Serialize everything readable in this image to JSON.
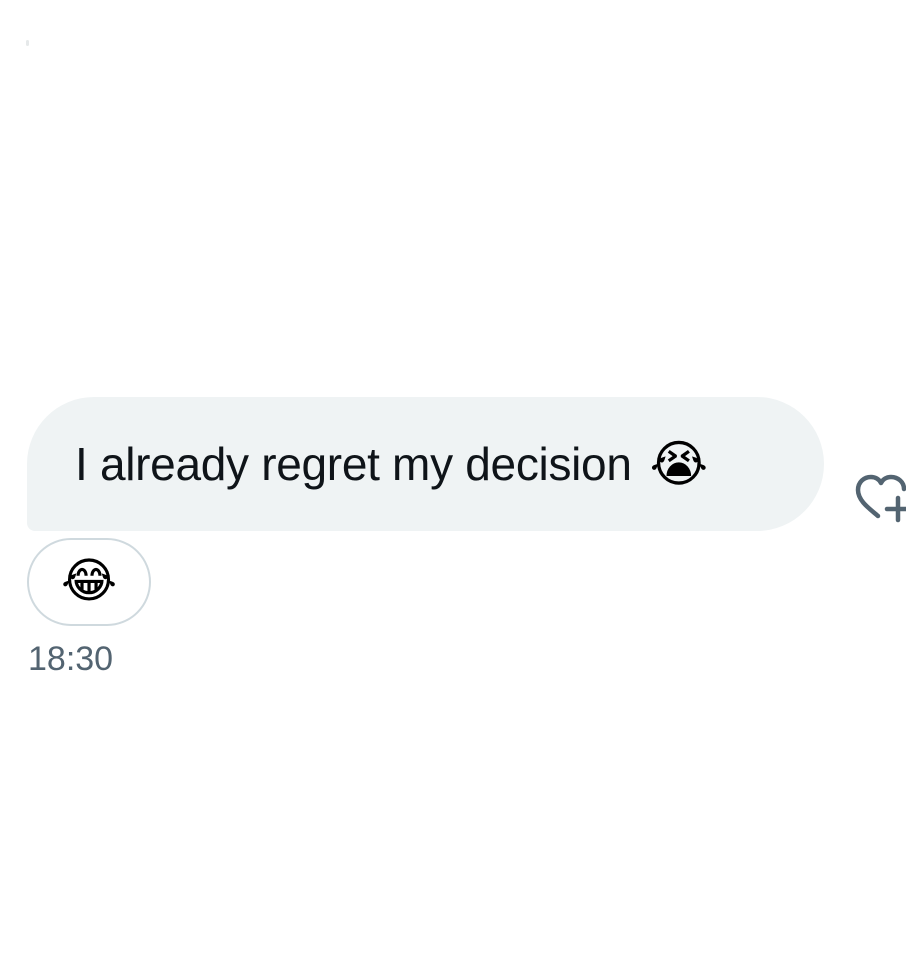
{
  "message": {
    "text": "I already regret my decision",
    "emoji": "😭",
    "bubble_color": "#eff3f4",
    "text_color": "#0f1419"
  },
  "reaction": {
    "emoji": "😂",
    "border_color": "#cfd9de"
  },
  "react_button": {
    "icon": "heart-plus-icon",
    "color": "#536471"
  },
  "timestamp": {
    "text": "18:30",
    "color": "#536471"
  }
}
